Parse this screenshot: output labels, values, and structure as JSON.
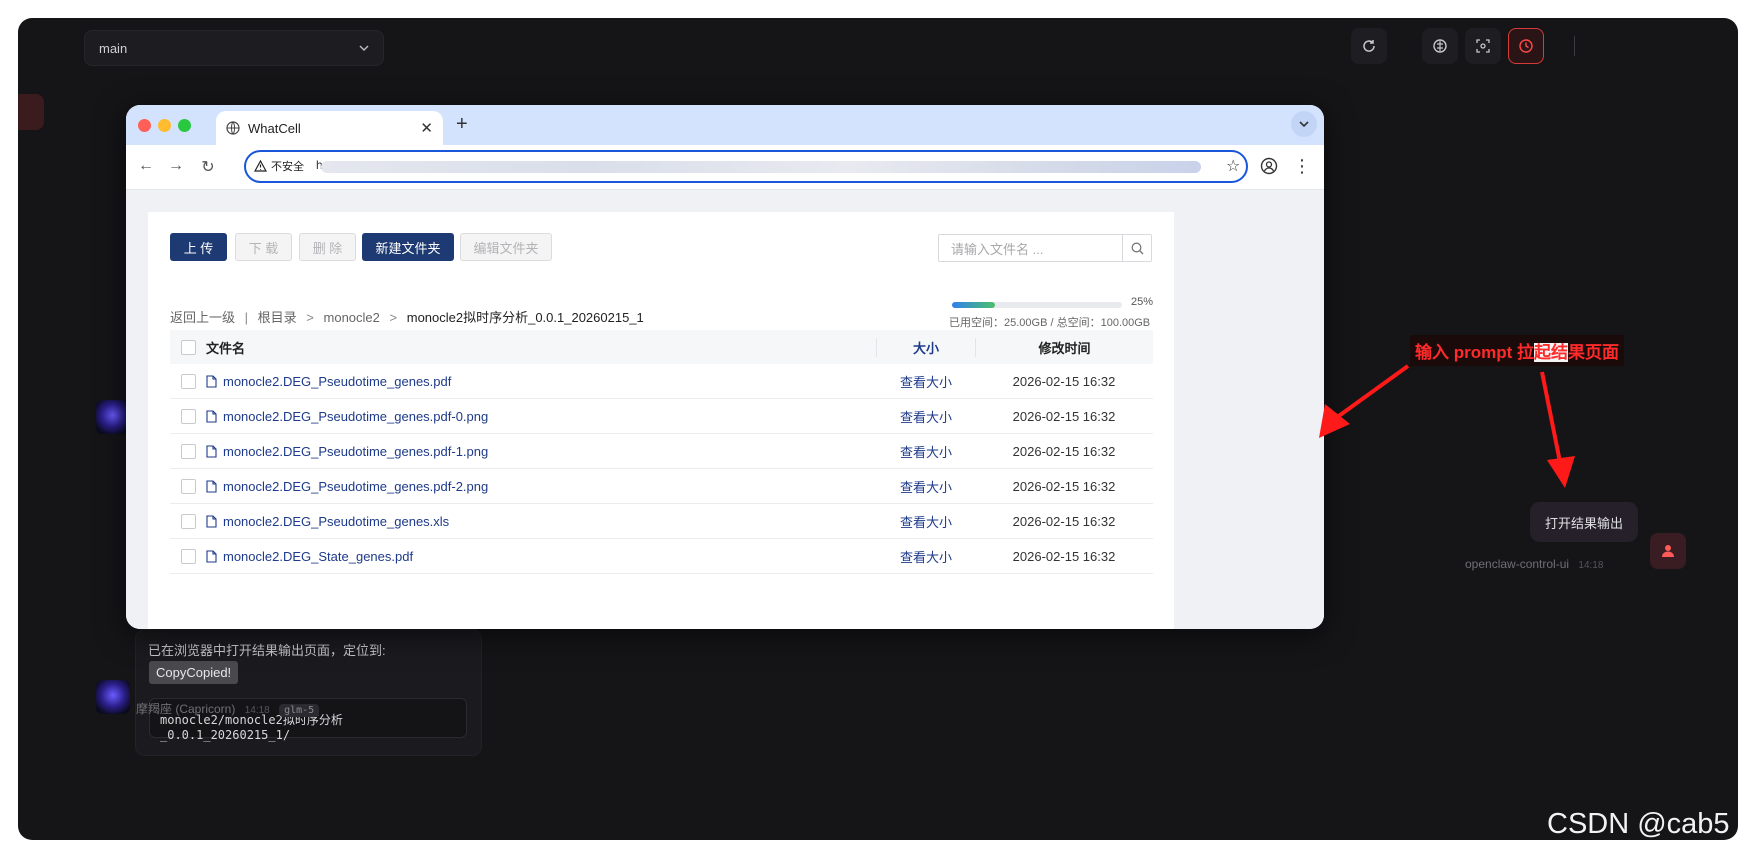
{
  "app": {
    "branch": "main",
    "message": {
      "text": "已在浏览器中打开结果输出页面，定位到:",
      "copy_label": "CopyCopied!",
      "path": "monocle2/monocle2拟时序分析_0.0.1_20260215_1/",
      "author": "摩羯座 (Capricorn)",
      "time": "14:18",
      "model": "glm-5"
    },
    "user_message": {
      "text": "打开结果输出",
      "author": "openclaw-control-ui",
      "time": "14:18"
    },
    "top_icons": [
      "refresh-icon",
      "brain-icon",
      "focus-icon",
      "clock-icon"
    ]
  },
  "browser": {
    "tab_title": "WhatCell",
    "security_label": "不安全",
    "url_prefix": "h",
    "toolbar": {
      "upload": "上 传",
      "download": "下 载",
      "delete": "删 除",
      "new_folder": "新建文件夹",
      "edit_folder": "编辑文件夹"
    },
    "search_placeholder": "请输入文件名 ...",
    "breadcrumb": {
      "back": "返回上一级",
      "root": "根目录",
      "level1": "monocle2",
      "current": "monocle2拟时序分析_0.0.1_20260215_1"
    },
    "storage": {
      "percent_label": "25%",
      "percent": 25,
      "text": "已用空间：25.00GB / 总空间：100.00GB"
    },
    "table": {
      "headers": {
        "name": "文件名",
        "size": "大小",
        "modified": "修改时间"
      },
      "rows": [
        {
          "name": "monocle2.DEG_Pseudotime_genes.pdf",
          "size": "查看大小",
          "modified": "2026-02-15 16:32"
        },
        {
          "name": "monocle2.DEG_Pseudotime_genes.pdf-0.png",
          "size": "查看大小",
          "modified": "2026-02-15 16:32"
        },
        {
          "name": "monocle2.DEG_Pseudotime_genes.pdf-1.png",
          "size": "查看大小",
          "modified": "2026-02-15 16:32"
        },
        {
          "name": "monocle2.DEG_Pseudotime_genes.pdf-2.png",
          "size": "查看大小",
          "modified": "2026-02-15 16:32"
        },
        {
          "name": "monocle2.DEG_Pseudotime_genes.xls",
          "size": "查看大小",
          "modified": "2026-02-15 16:32"
        },
        {
          "name": "monocle2.DEG_State_genes.pdf",
          "size": "查看大小",
          "modified": "2026-02-15 16:32"
        }
      ]
    }
  },
  "annotation": {
    "before": "输入 prompt 拉",
    "highlight": "起结",
    "after": "果页面"
  },
  "watermark": "CSDN @cab5",
  "colors": {
    "primary_button": "#1e3a72",
    "link": "#1e3a8a",
    "annotation_red": "#ff2a2a",
    "app_background": "#151518"
  }
}
